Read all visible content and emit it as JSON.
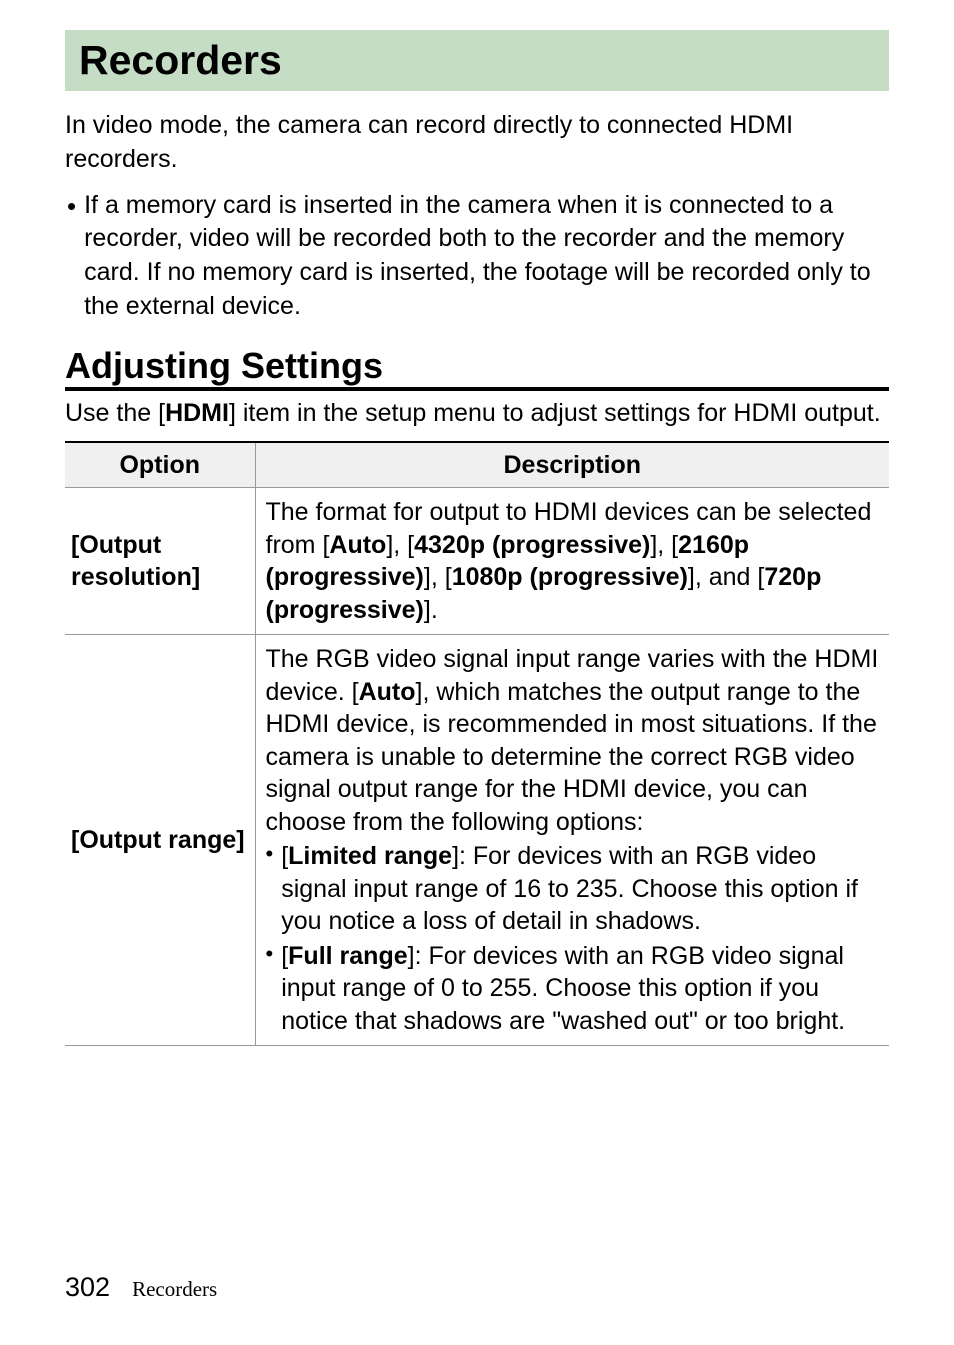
{
  "section_title": "Recorders",
  "intro": "In video mode, the camera can record directly to connected HDMI recorders.",
  "bullet_main": "If a memory card is inserted in the camera when it is connected to a recorder, video will be recorded both to the recorder and the memory card. If no memory card is inserted, the footage will be recorded only to the external device.",
  "subheading": "Adjusting Settings",
  "sub_intro_pre": "Use the [",
  "sub_intro_bold": "HDMI",
  "sub_intro_post": "] item in the setup menu to adjust settings for HDMI output.",
  "table": {
    "headers": {
      "option": "Option",
      "description": "Description"
    },
    "rows": [
      {
        "option_pre": "[",
        "option_bold": "Output resolution",
        "option_post": "]",
        "desc_p1_pre": "The format for output to HDMI devices can be selected from [",
        "desc_p1_b1": "Auto",
        "desc_p1_mid1": "], [",
        "desc_p1_b2": "4320p (progressive)",
        "desc_p1_mid2": "], [",
        "desc_p1_b3": "2160p (progressive)",
        "desc_p1_mid3": "], [",
        "desc_p1_b4": "1080p (progressive)",
        "desc_p1_mid4": "], and [",
        "desc_p1_b5": "720p (progressive)",
        "desc_p1_post": "]."
      },
      {
        "option_pre": "[",
        "option_bold": "Output range",
        "option_post": "]",
        "p_pre": "The RGB video signal input range varies with the HDMI device. [",
        "p_b": "Auto",
        "p_post": "], which matches the output range to the HDMI device, is recommended in most situations. If the camera is unable to determine the correct RGB video signal output range for the HDMI device, you can choose from the following options:",
        "b1_pre": "[",
        "b1_b": "Limited range",
        "b1_post": "]: For devices with an RGB video signal input range of 16 to 235. Choose this option if you notice a loss of detail in shadows.",
        "b2_pre": "[",
        "b2_b": "Full range",
        "b2_post": "]: For devices with an RGB video signal input range of 0 to 255. Choose this option if you notice that shadows are \"washed out\" or too bright."
      }
    ]
  },
  "footer": {
    "page": "302",
    "label": "Recorders"
  }
}
